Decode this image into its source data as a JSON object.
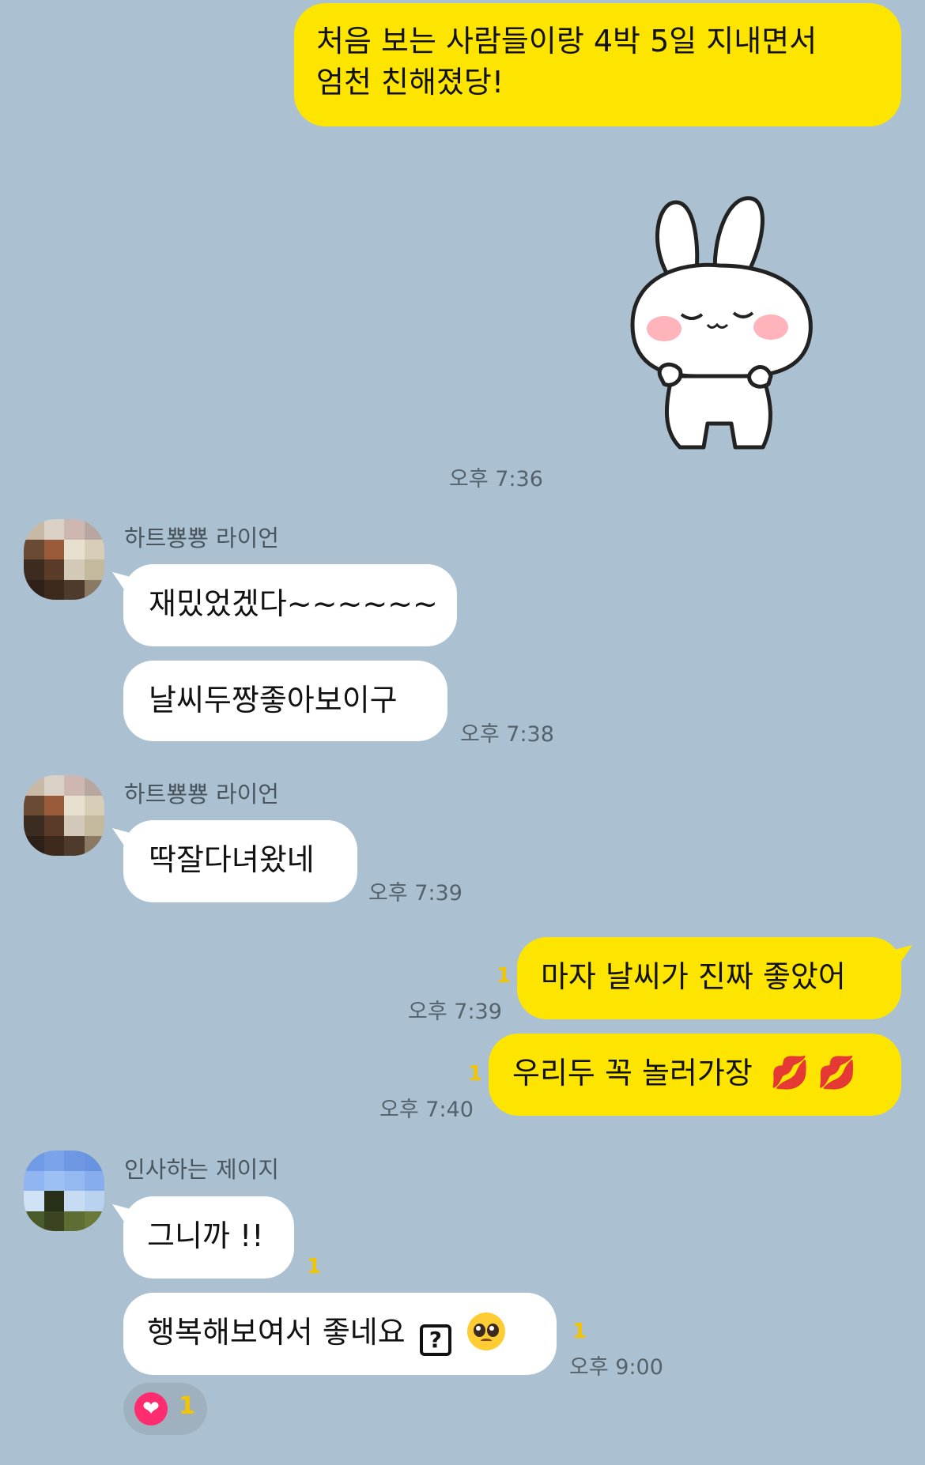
{
  "messages": {
    "m1": {
      "line1": "처음 보는 사람들이랑 4박 5일 지내면서",
      "line2": "엄천 친해졌당!"
    },
    "m2_time": "오후 7:36",
    "sender1": "하트뿅뿅 라이언",
    "m3": "재밌었겠다~~~~~~",
    "m4": "날씨두짱좋아보이구",
    "m4_time": "오후 7:38",
    "sender2": "하트뿅뿅 라이언",
    "m5": "딱잘다녀왔네",
    "m5_time": "오후 7:39",
    "m6": "마자 날씨가 진짜 좋았어",
    "m6_unread": "1",
    "m6_time": "오후 7:39",
    "m7": "우리두 꼭 놀러가장",
    "m7_unread": "1",
    "m7_time": "오후 7:40",
    "sender3": "인사하는 제이지",
    "m8": "그니까 !!",
    "m8_unread": "1",
    "m9": "행복해보여서 좋네요",
    "m9_box": "?",
    "m9_unread": "1",
    "m9_time": "오후 9:00",
    "reaction_count": "1"
  },
  "icons": {
    "sticker": "white-bunny-sticker",
    "reaction": "heart-icon",
    "lips": "kiss-mark-icon",
    "question_box": "question-box-icon",
    "pleading": "pleading-face-icon"
  },
  "colors": {
    "background": "#abc1d1",
    "my_bubble": "#fee500",
    "their_bubble": "#ffffff",
    "unread": "#f2c500"
  }
}
